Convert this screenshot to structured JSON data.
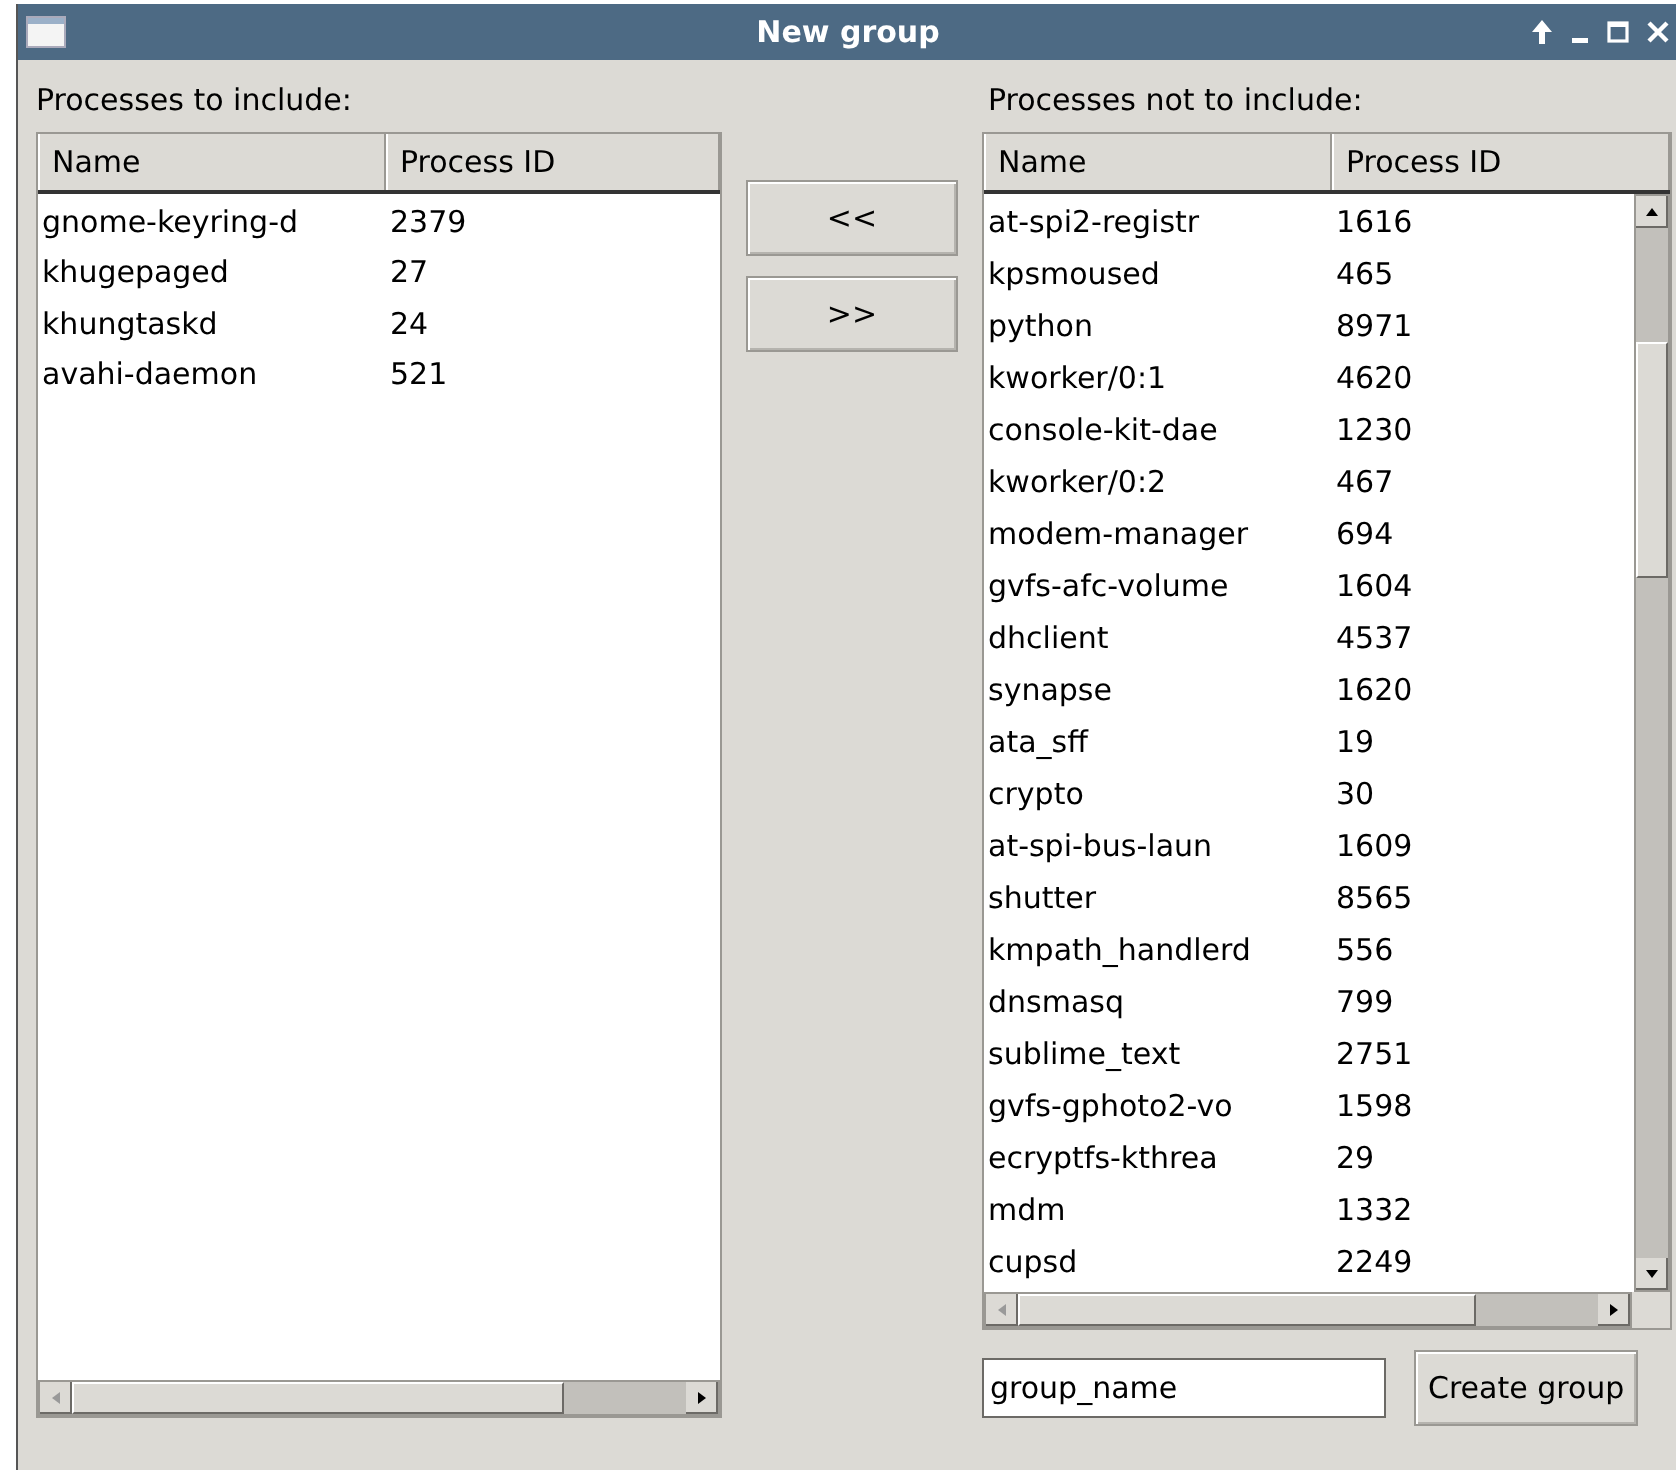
{
  "window": {
    "title": "New group"
  },
  "include": {
    "label": "Processes to include:",
    "columns": [
      "Name",
      "Process ID"
    ],
    "rows": [
      {
        "name": "gnome-keyring-d",
        "pid": "2379"
      },
      {
        "name": "khugepaged",
        "pid": "27"
      },
      {
        "name": "khungtaskd",
        "pid": "24"
      },
      {
        "name": "avahi-daemon",
        "pid": "521"
      }
    ]
  },
  "move_buttons": [
    "<<",
    ">>"
  ],
  "exclude": {
    "label": "Processes not to include:",
    "columns": [
      "Name",
      "Process ID"
    ],
    "rows": [
      {
        "name": "at-spi2-registr",
        "pid": "1616"
      },
      {
        "name": "kpsmoused",
        "pid": "465"
      },
      {
        "name": "python",
        "pid": "8971"
      },
      {
        "name": "kworker/0:1",
        "pid": "4620"
      },
      {
        "name": "console-kit-dae",
        "pid": "1230"
      },
      {
        "name": "kworker/0:2",
        "pid": "467"
      },
      {
        "name": "modem-manager",
        "pid": "694"
      },
      {
        "name": "gvfs-afc-volume",
        "pid": "1604"
      },
      {
        "name": "dhclient",
        "pid": "4537"
      },
      {
        "name": "synapse",
        "pid": "1620"
      },
      {
        "name": "ata_sff",
        "pid": "19"
      },
      {
        "name": "crypto",
        "pid": "30"
      },
      {
        "name": "at-spi-bus-laun",
        "pid": "1609"
      },
      {
        "name": "shutter",
        "pid": "8565"
      },
      {
        "name": "kmpath_handlerd",
        "pid": "556"
      },
      {
        "name": "dnsmasq",
        "pid": "799"
      },
      {
        "name": "sublime_text",
        "pid": "2751"
      },
      {
        "name": "gvfs-gphoto2-vo",
        "pid": "1598"
      },
      {
        "name": "ecryptfs-kthrea",
        "pid": "29"
      },
      {
        "name": "mdm",
        "pid": "1332"
      },
      {
        "name": "cupsd",
        "pid": "2249"
      }
    ]
  },
  "group_name_field": {
    "value": "group_name"
  },
  "create_button": "Create group"
}
